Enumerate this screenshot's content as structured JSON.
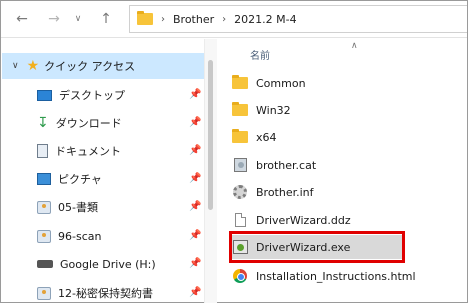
{
  "address_bar": {
    "breadcrumb": [
      "Brother",
      "2021.2 M-4"
    ]
  },
  "nav_buttons": {
    "back_icon": "arrow-left-icon",
    "forward_icon": "arrow-right-icon",
    "recent_icon": "chevron-down-icon",
    "up_icon": "arrow-up-icon"
  },
  "sidebar": {
    "quick_access_label": "クイック アクセス",
    "items": [
      {
        "label": "デスクトップ",
        "icon": "desktop-icon",
        "pinned": true
      },
      {
        "label": "ダウンロード",
        "icon": "download-icon",
        "pinned": true
      },
      {
        "label": "ドキュメント",
        "icon": "documents-icon",
        "pinned": true
      },
      {
        "label": "ピクチャ",
        "icon": "pictures-icon",
        "pinned": true
      },
      {
        "label": "05-書類",
        "icon": "folder-icon",
        "pinned": true
      },
      {
        "label": "96-scan",
        "icon": "folder-icon",
        "pinned": true
      },
      {
        "label": "Google Drive (H:)",
        "icon": "drive-icon",
        "pinned": true
      },
      {
        "label": "12-秘密保持契約書",
        "icon": "folder-icon",
        "pinned": true
      }
    ]
  },
  "file_list": {
    "column_name": "名前",
    "files": [
      {
        "name": "Common",
        "icon": "folder-icon"
      },
      {
        "name": "Win32",
        "icon": "folder-icon"
      },
      {
        "name": "x64",
        "icon": "folder-icon"
      },
      {
        "name": "brother.cat",
        "icon": "security-catalog-icon"
      },
      {
        "name": "Brother.inf",
        "icon": "setup-information-icon"
      },
      {
        "name": "DriverWizard.ddz",
        "icon": "file-icon"
      },
      {
        "name": "DriverWizard.exe",
        "icon": "application-icon",
        "selected": true,
        "highlighted": true
      },
      {
        "name": "Installation_Instructions.html",
        "icon": "chrome-html-icon"
      }
    ]
  },
  "colors": {
    "highlight_border": "#e00000",
    "quick_access_bg": "#cce8ff",
    "selected_row_bg": "#d9d9d9",
    "folder_yellow": "#f7c43a"
  }
}
